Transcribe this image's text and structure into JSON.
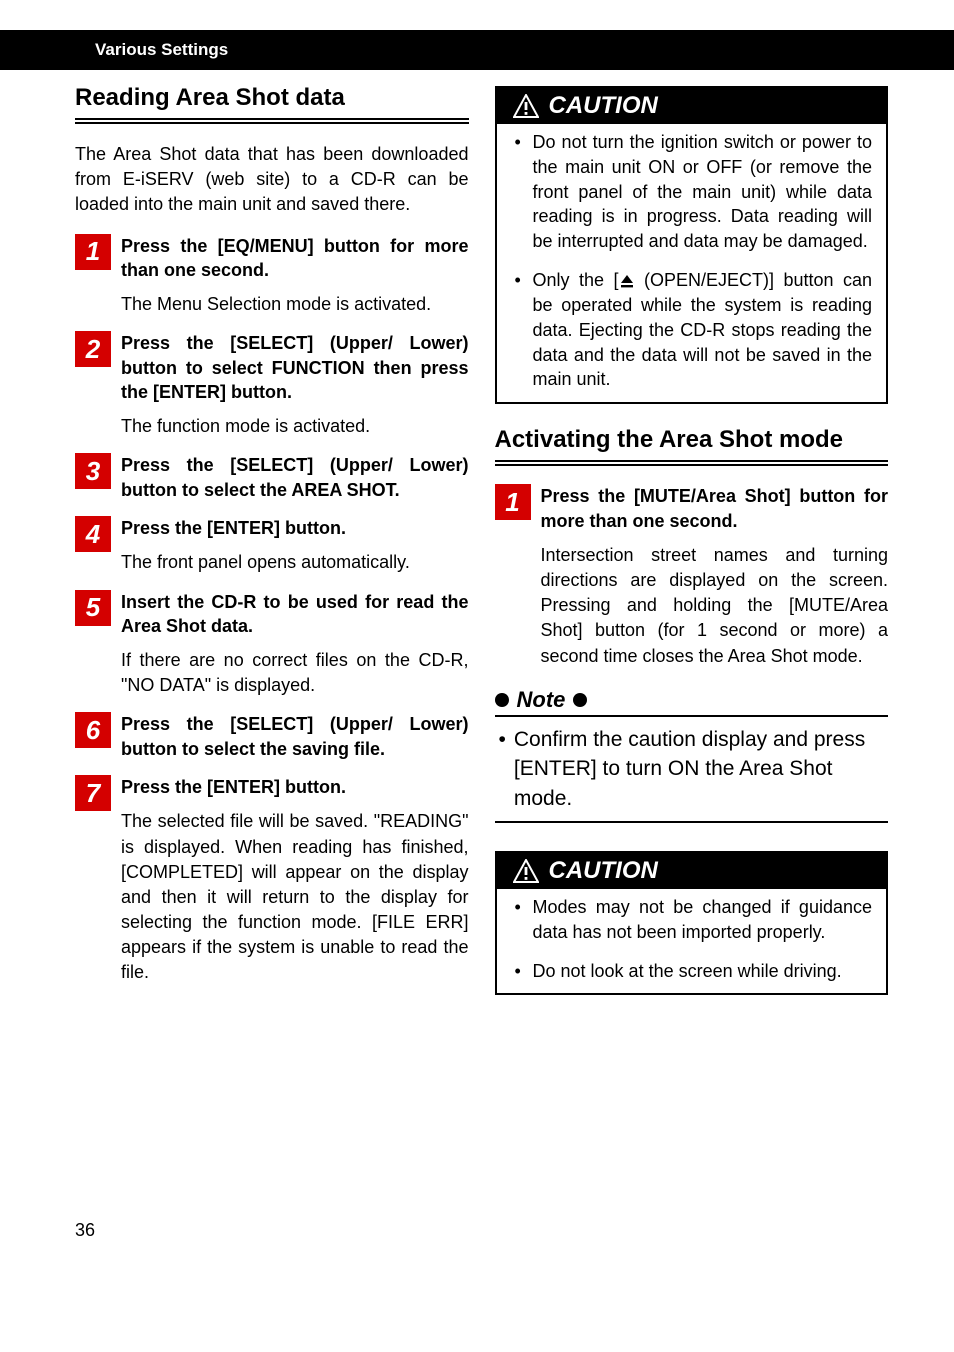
{
  "header": {
    "breadcrumb": "Various Settings"
  },
  "left": {
    "title": "Reading Area Shot data",
    "intro": "The Area Shot data that has been downloaded from E-iSERV (web site) to a CD-R can be loaded into the main unit and saved there.",
    "steps": [
      {
        "num": "1",
        "bold": "Press the [EQ/MENU] button for more than one second.",
        "desc": "The Menu Selection mode is activated."
      },
      {
        "num": "2",
        "bold": "Press the [SELECT] (Upper/ Lower) button to select FUNCTION then press the [ENTER] button.",
        "desc": "The function mode is activated."
      },
      {
        "num": "3",
        "bold": "Press the [SELECT] (Upper/ Lower) button to select the AREA SHOT.",
        "desc": ""
      },
      {
        "num": "4",
        "bold": "Press the [ENTER] button.",
        "desc": "The front panel opens automatically."
      },
      {
        "num": "5",
        "bold": "Insert the CD-R to be used for read the Area Shot data.",
        "desc": "If there are no correct files on the CD-R, \"NO DATA\" is displayed."
      },
      {
        "num": "6",
        "bold": "Press the [SELECT] (Upper/ Lower)  button to select the saving file.",
        "desc": ""
      },
      {
        "num": "7",
        "bold": "Press the  [ENTER] button.",
        "desc": "The selected file will be saved. \"READING\" is displayed. When reading has finished, [COMPLETED] will appear on the display and then it will return to the display for selecting the function mode. [FILE ERR] appears if the system is unable to read the file."
      }
    ]
  },
  "right": {
    "caution1": {
      "label": "CAUTION",
      "items": [
        "Do not turn the ignition switch or power to the main unit ON or OFF (or remove the front panel of the main unit) while data reading is in progress. Data reading will be interrupted and data may be damaged.",
        "Only the [⏏ (OPEN/EJECT)] button can be operated while the system is reading data. Ejecting the CD-R stops reading the data and the data will not be saved in the main unit."
      ],
      "item2_prefix": "Only the [",
      "item2_mid": " (OPEN/EJECT)] button can be operated while the system is reading data. Ejecting the CD-R stops reading the data and the data will not be saved in the main unit."
    },
    "title2": "Activating the Area Shot mode",
    "step": {
      "num": "1",
      "bold": "Press the [MUTE/Area Shot] button for more than one second.",
      "desc": "Intersection street names and turning directions are displayed on the screen. Pressing and holding the [MUTE/Area Shot] button (for 1 second or more) a second time closes the Area Shot mode."
    },
    "note": {
      "label": "Note",
      "text": "Confirm the caution display and press [ENTER] to turn ON the Area Shot mode."
    },
    "caution2": {
      "label": "CAUTION",
      "items": [
        "Modes may not be changed if guidance data has not been imported properly.",
        "Do not look at the screen while driving."
      ]
    }
  },
  "page_number": "36"
}
